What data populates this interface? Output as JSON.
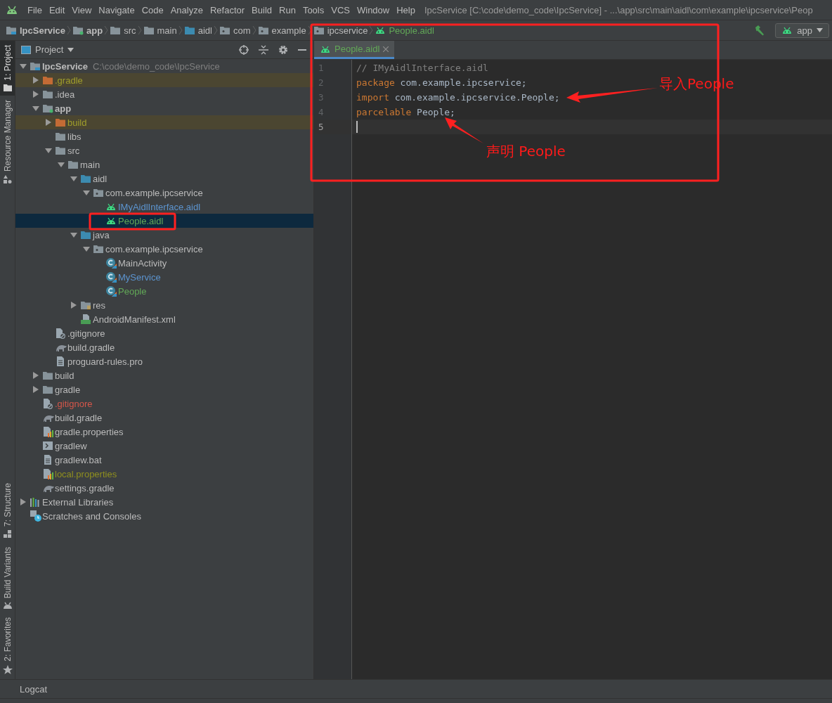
{
  "menu": [
    "File",
    "Edit",
    "View",
    "Navigate",
    "Code",
    "Analyze",
    "Refactor",
    "Build",
    "Run",
    "Tools",
    "VCS",
    "Window",
    "Help"
  ],
  "window_title": "IpcService [C:\\code\\demo_code\\IpcService] - ...\\app\\src\\main\\aidl\\com\\example\\ipcservice\\Peop",
  "breadcrumbs": [
    {
      "label": "IpcService",
      "kind": "project"
    },
    {
      "label": "app",
      "kind": "module"
    },
    {
      "label": "src",
      "kind": "folder"
    },
    {
      "label": "main",
      "kind": "folder"
    },
    {
      "label": "aidl",
      "kind": "source"
    },
    {
      "label": "com",
      "kind": "package"
    },
    {
      "label": "example",
      "kind": "package"
    },
    {
      "label": "ipcservice",
      "kind": "package"
    },
    {
      "label": "People.aidl",
      "kind": "android"
    }
  ],
  "run_config": "app",
  "left_strip": {
    "top": [
      {
        "label": "1: Project",
        "kind": "project",
        "selected": true
      },
      {
        "label": "Resource Manager",
        "kind": "resources",
        "selected": false
      }
    ],
    "bottom": [
      {
        "label": "7: Structure",
        "kind": "structure",
        "selected": false
      },
      {
        "label": "Build Variants",
        "kind": "variants",
        "selected": false
      },
      {
        "label": "2: Favorites",
        "kind": "favorites",
        "selected": false
      }
    ]
  },
  "project_panel": {
    "title": "Project",
    "tree": [
      {
        "name": "IpcService",
        "kind": "root",
        "path": "C:\\code\\demo_code\\IpcService",
        "color": "#bbbbbb",
        "expanded": true,
        "selected": false,
        "children": [
          {
            "name": ".gradle",
            "kind": "excluded",
            "color": "#a09e2b",
            "expanded": false,
            "selected": false
          },
          {
            "name": ".idea",
            "kind": "folder",
            "color": "#bbbbbb",
            "expanded": false,
            "selected": false
          },
          {
            "name": "app",
            "kind": "module",
            "color": "#bbbbbb",
            "expanded": true,
            "selected": false,
            "children": [
              {
                "name": "build",
                "kind": "excluded",
                "color": "#a09e2b",
                "expanded": false,
                "selected": false
              },
              {
                "name": "libs",
                "kind": "folder",
                "color": "#bbbbbb",
                "selected": false
              },
              {
                "name": "src",
                "kind": "folder",
                "color": "#bbbbbb",
                "expanded": true,
                "selected": false,
                "children": [
                  {
                    "name": "main",
                    "kind": "folder",
                    "color": "#bbbbbb",
                    "expanded": true,
                    "selected": false,
                    "children": [
                      {
                        "name": "aidl",
                        "kind": "source",
                        "color": "#bbbbbb",
                        "expanded": true,
                        "selected": false,
                        "children": [
                          {
                            "name": "com.example.ipcservice",
                            "kind": "package",
                            "color": "#bbbbbb",
                            "expanded": true,
                            "selected": false,
                            "children": [
                              {
                                "name": "IMyAidlInterface.aidl",
                                "kind": "android",
                                "color": "#5c94cf",
                                "selected": false
                              },
                              {
                                "name": "People.aidl",
                                "kind": "android",
                                "color": "#62a857",
                                "selected": true
                              }
                            ]
                          }
                        ]
                      },
                      {
                        "name": "java",
                        "kind": "source",
                        "color": "#bbbbbb",
                        "expanded": true,
                        "selected": false,
                        "children": [
                          {
                            "name": "com.example.ipcservice",
                            "kind": "package",
                            "color": "#bbbbbb",
                            "expanded": true,
                            "selected": false,
                            "children": [
                              {
                                "name": "MainActivity",
                                "kind": "class",
                                "color": "#bbbbbb",
                                "selected": false
                              },
                              {
                                "name": "MyService",
                                "kind": "class",
                                "color": "#5c94cf",
                                "selected": false
                              },
                              {
                                "name": "People",
                                "kind": "class",
                                "color": "#62a857",
                                "selected": false
                              }
                            ]
                          }
                        ]
                      },
                      {
                        "name": "res",
                        "kind": "resources",
                        "color": "#bbbbbb",
                        "expanded": false,
                        "selected": false
                      },
                      {
                        "name": "AndroidManifest.xml",
                        "kind": "manifest",
                        "color": "#bbbbbb",
                        "selected": false
                      }
                    ]
                  }
                ]
              },
              {
                "name": ".gitignore",
                "kind": "ignore",
                "color": "#bbbbbb",
                "selected": false
              },
              {
                "name": "build.gradle",
                "kind": "gradle",
                "color": "#bbbbbb",
                "selected": false
              },
              {
                "name": "proguard-rules.pro",
                "kind": "text",
                "color": "#bbbbbb",
                "selected": false
              }
            ]
          },
          {
            "name": "build",
            "kind": "folder",
            "color": "#bbbbbb",
            "expanded": false,
            "selected": false
          },
          {
            "name": "gradle",
            "kind": "folder",
            "color": "#bbbbbb",
            "expanded": false,
            "selected": false
          },
          {
            "name": ".gitignore",
            "kind": "ignore",
            "color": "#d5564a",
            "selected": false
          },
          {
            "name": "build.gradle",
            "kind": "gradle",
            "color": "#bbbbbb",
            "selected": false
          },
          {
            "name": "gradle.properties",
            "kind": "properties",
            "color": "#bbbbbb",
            "selected": false
          },
          {
            "name": "gradlew",
            "kind": "script",
            "color": "#bbbbbb",
            "selected": false
          },
          {
            "name": "gradlew.bat",
            "kind": "text",
            "color": "#bbbbbb",
            "selected": false
          },
          {
            "name": "local.properties",
            "kind": "properties",
            "color": "#8f8f1f",
            "selected": false
          },
          {
            "name": "settings.gradle",
            "kind": "gradle",
            "color": "#bbbbbb",
            "selected": false
          }
        ]
      },
      {
        "name": "External Libraries",
        "kind": "libraries",
        "color": "#bbbbbb",
        "expanded": false,
        "selected": false
      },
      {
        "name": "Scratches and Consoles",
        "kind": "scratches",
        "color": "#bbbbbb",
        "selected": false
      }
    ]
  },
  "editor": {
    "tabs": [
      {
        "label": "People.aidl",
        "selected": true
      }
    ],
    "lines": [
      {
        "number": "1",
        "current": false,
        "tokens": [
          {
            "text": "// IMyAidlInterface.aidl",
            "kind": "comment"
          }
        ]
      },
      {
        "number": "2",
        "current": false,
        "tokens": [
          {
            "text": "package",
            "kind": "keyword"
          },
          {
            "text": " com.example.ipcservice;",
            "kind": "plain"
          }
        ]
      },
      {
        "number": "3",
        "current": false,
        "tokens": [
          {
            "text": "import",
            "kind": "keyword"
          },
          {
            "text": " com.example.ipcservice.People;",
            "kind": "plain"
          }
        ]
      },
      {
        "number": "4",
        "current": false,
        "tokens": [
          {
            "text": "parcelable",
            "kind": "keyword"
          },
          {
            "text": " People;",
            "kind": "plain"
          }
        ]
      },
      {
        "number": "5",
        "current": true
      }
    ]
  },
  "annotations": [
    "导入People",
    "声明 People"
  ],
  "bottom_bar": {
    "tabs": [
      "Logcat"
    ]
  }
}
